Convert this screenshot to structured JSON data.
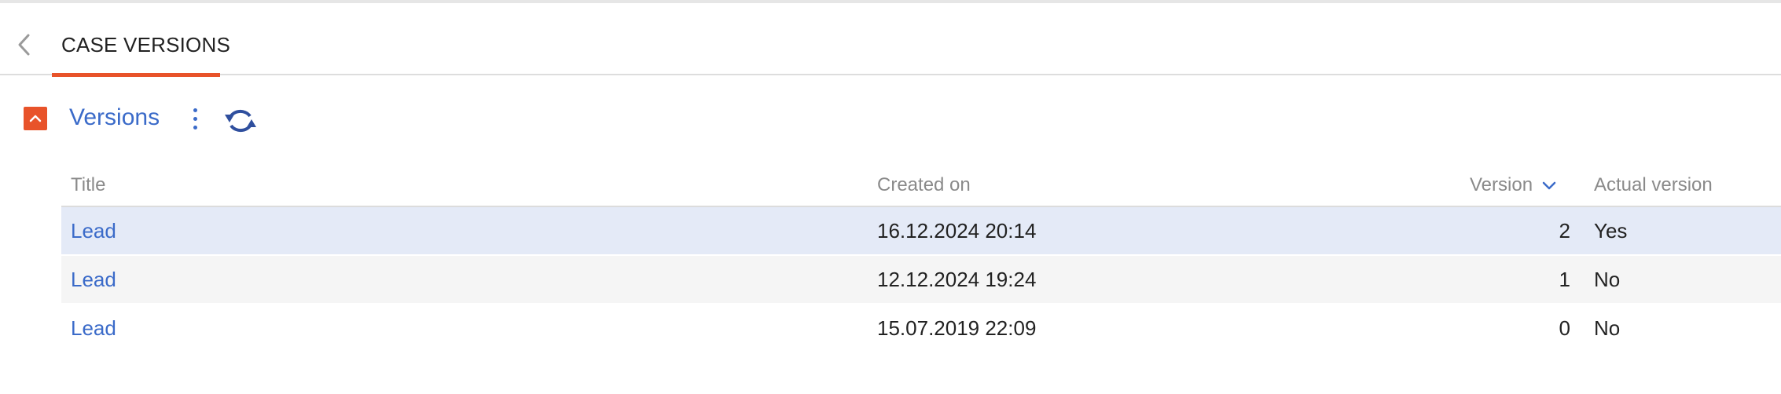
{
  "tabbar": {
    "back_icon": "chevron-left-icon",
    "active_tab": "CASE VERSIONS"
  },
  "section": {
    "collapse_icon": "chevron-up-icon",
    "title": "Versions",
    "menu_icon": "kebab-menu-icon",
    "refresh_icon": "refresh-icon"
  },
  "colors": {
    "accent": "#e8532a",
    "link": "#3b6bc9",
    "selected_row": "#e4eaf7",
    "alt_row": "#f5f5f5"
  },
  "grid": {
    "columns": {
      "title": "Title",
      "created_on": "Created on",
      "version": "Version",
      "actual_version": "Actual version"
    },
    "sort": {
      "column": "version",
      "direction": "descending",
      "icon": "chevron-down-icon"
    },
    "rows": [
      {
        "title": "Lead",
        "created_on": "16.12.2024 20:14",
        "version": "2",
        "actual_version": "Yes",
        "selected": true
      },
      {
        "title": "Lead",
        "created_on": "12.12.2024 19:24",
        "version": "1",
        "actual_version": "No",
        "selected": false
      },
      {
        "title": "Lead",
        "created_on": "15.07.2019 22:09",
        "version": "0",
        "actual_version": "No",
        "selected": false
      }
    ]
  }
}
